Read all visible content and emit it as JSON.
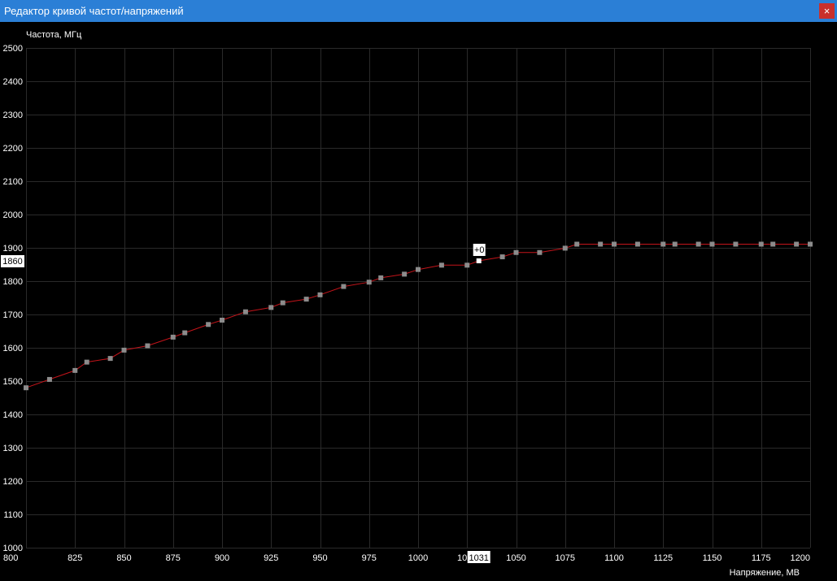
{
  "window": {
    "title": "Редактор кривой частот/напряжений",
    "close_label": "×"
  },
  "chart_data": {
    "type": "line",
    "ylabel": "Частота, МГц",
    "xlabel": "Напряжение, МВ",
    "xlim": [
      800,
      1200
    ],
    "ylim": [
      1000,
      2500
    ],
    "x_ticks": [
      800,
      825,
      850,
      875,
      900,
      925,
      950,
      975,
      1000,
      1025,
      1050,
      1075,
      1100,
      1125,
      1150,
      1175,
      1200
    ],
    "x_tick_labels": [
      "800",
      "825",
      "850",
      "875",
      "900",
      "925",
      "950",
      "975",
      "1000",
      "1025",
      "1050",
      "1075",
      "1100",
      "1125",
      "1150",
      "1175",
      "1200"
    ],
    "y_ticks": [
      1000,
      1100,
      1200,
      1300,
      1400,
      1500,
      1600,
      1700,
      1800,
      1900,
      2000,
      2100,
      2200,
      2300,
      2400,
      2500
    ],
    "y_tick_labels": [
      "1000",
      "1100",
      "1200",
      "1300",
      "1400",
      "1500",
      "1600",
      "1700",
      "1800",
      "1900",
      "2000",
      "2100",
      "2200",
      "2300",
      "2400",
      "2500"
    ],
    "grid": true,
    "series_color": "#c4141a",
    "point_color": "#8c8c8c",
    "selected_point_color": "#ffffff",
    "series": [
      {
        "x": [
          800,
          812,
          825,
          831,
          843,
          850,
          862,
          875,
          881,
          893,
          900,
          912,
          925,
          931,
          943,
          950,
          962,
          975,
          981,
          993,
          1000,
          1012,
          1025,
          1031,
          1043,
          1050,
          1062,
          1075,
          1081,
          1093,
          1100,
          1112,
          1125,
          1131,
          1143,
          1150,
          1162,
          1175,
          1181,
          1193,
          1200
        ],
        "y": [
          1480,
          1505,
          1532,
          1557,
          1568,
          1593,
          1606,
          1632,
          1645,
          1670,
          1683,
          1708,
          1721,
          1735,
          1746,
          1759,
          1784,
          1797,
          1810,
          1821,
          1835,
          1848,
          1848,
          1861,
          1873,
          1886,
          1886,
          1899,
          1911,
          1911,
          1911,
          1911,
          1911,
          1911,
          1911,
          1911,
          1911,
          1911,
          1911,
          1911,
          1911
        ]
      }
    ],
    "selected_point": {
      "x": 1031,
      "y": 1861,
      "x_label": "1031",
      "y_label": "1860",
      "offset_label": "+0"
    }
  }
}
